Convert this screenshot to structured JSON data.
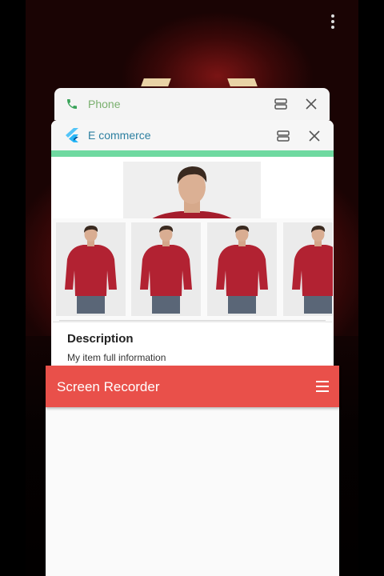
{
  "recents": {
    "overflow_menu_icon": "more-vertical-icon",
    "phone_card": {
      "title": "Phone",
      "icon": "phone-icon",
      "split_screen_icon": "split-screen-icon",
      "close_icon": "close-icon"
    },
    "ecommerce_card": {
      "title": "E commerce",
      "icon": "flutter-icon",
      "split_screen_icon": "split-screen-icon",
      "close_icon": "close-icon",
      "accent_color": "#6fd9a0",
      "description_heading": "Description",
      "description_text": "My item full information",
      "thumbnails": [
        "shirt-photo",
        "shirt-photo",
        "shirt-photo",
        "shirt-photo"
      ]
    },
    "recorder_card": {
      "title": "Screen Recorder",
      "menu_icon": "hamburger-menu-icon",
      "bar_color": "#e9504a"
    }
  }
}
